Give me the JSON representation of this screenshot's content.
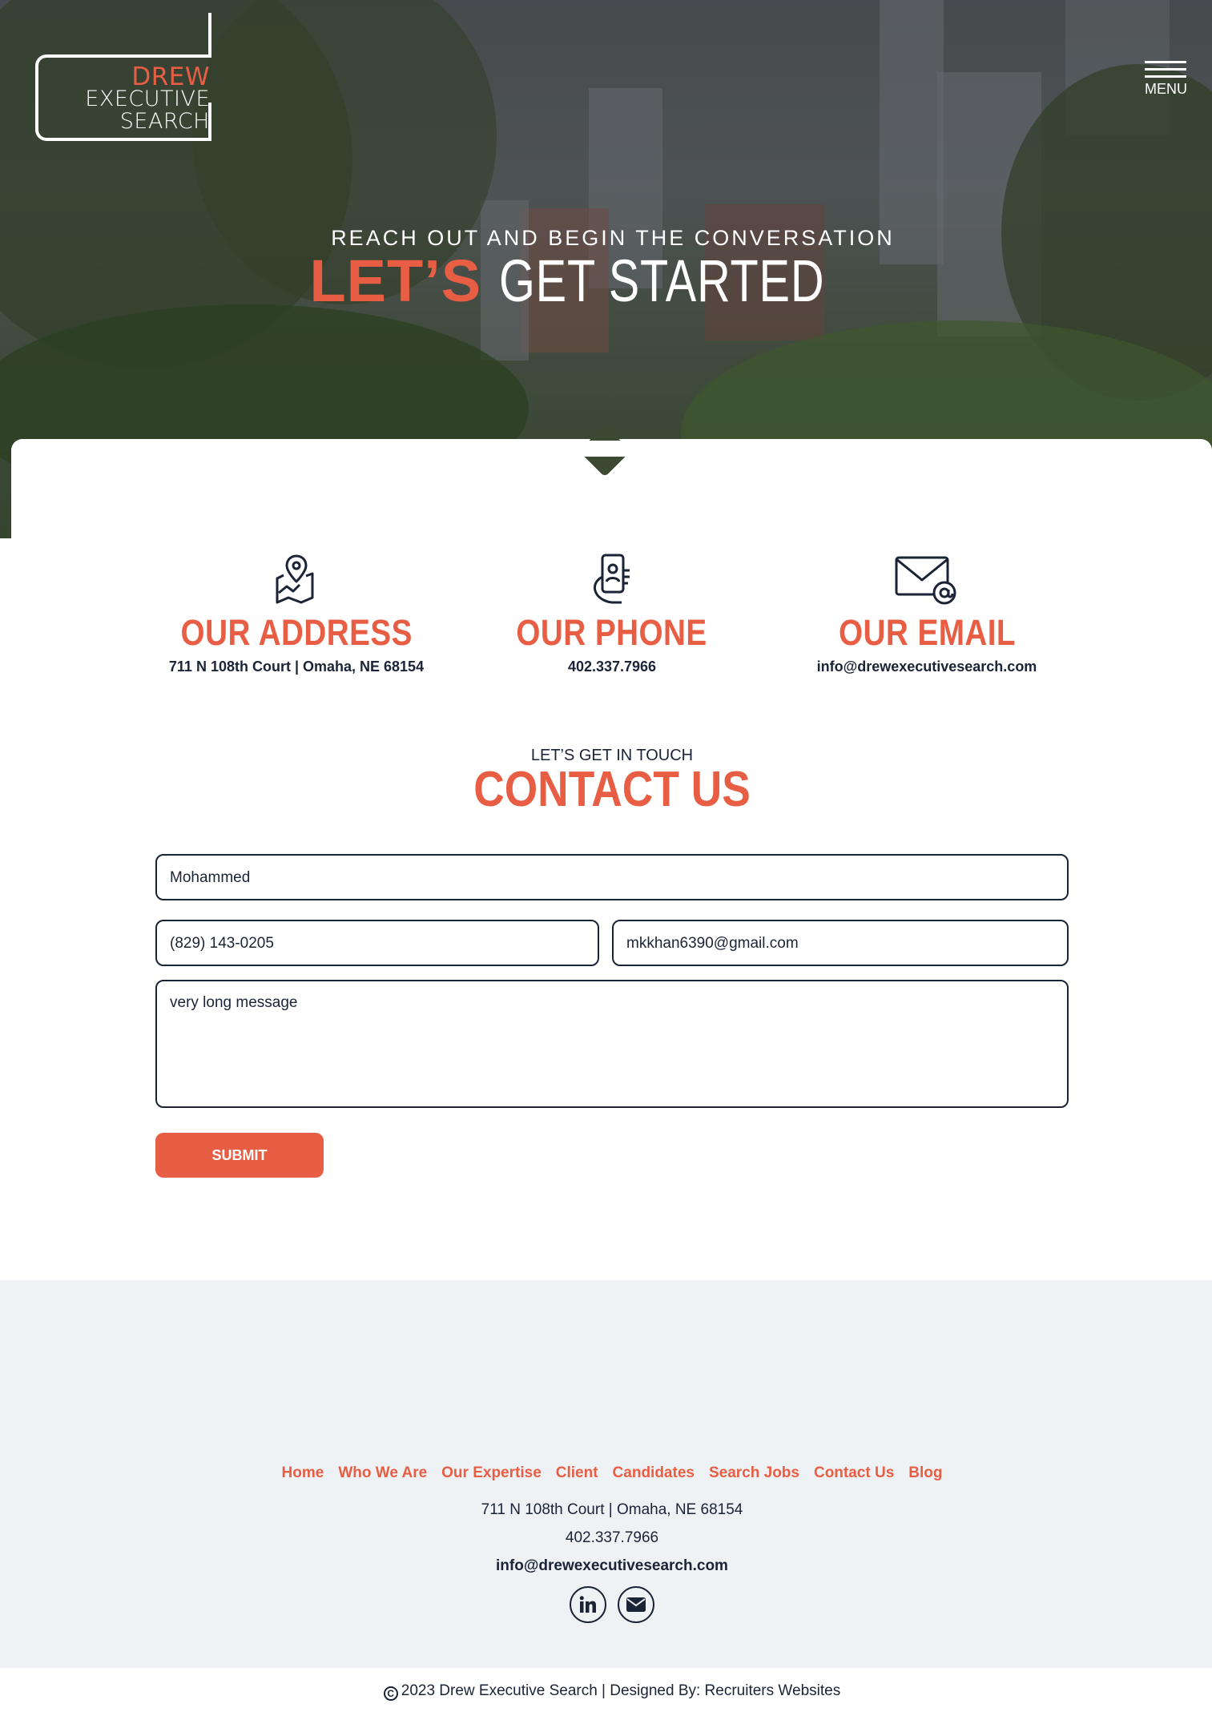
{
  "header": {
    "logo": {
      "line1": "DREW",
      "line2": "EXECUTIVE",
      "line3": "SEARCH"
    },
    "menu_label": "MENU"
  },
  "hero": {
    "kicker": "REACH OUT AND BEGIN THE CONVERSATION",
    "title_accent": "LET’S",
    "title_rest": "GET STARTED"
  },
  "info": [
    {
      "icon": "map-pin-icon",
      "title": "OUR ADDRESS",
      "value": "711 N 108th Court | Omaha, NE 68154"
    },
    {
      "icon": "phone-icon",
      "title": "OUR PHONE",
      "value": "402.337.7966"
    },
    {
      "icon": "email-icon",
      "title": "OUR EMAIL",
      "value": "info@drewexecutivesearch.com"
    }
  ],
  "contact": {
    "kicker": "LET’S GET IN TOUCH",
    "title": "CONTACT US",
    "name_value": "Mohammed",
    "phone_value": "(829) 143-0205",
    "email_value": "mkkhan6390@gmail.com",
    "message_value": "very long message",
    "submit_label": "SUBMIT"
  },
  "footer": {
    "nav": [
      "Home",
      "Who We Are",
      "Our Expertise",
      "Client",
      "Candidates",
      "Search Jobs",
      "Contact Us",
      "Blog"
    ],
    "address": "711 N 108th Court | Omaha, NE 68154",
    "phone": "402.337.7966",
    "email": "info@drewexecutivesearch.com",
    "social": [
      "linkedin-icon",
      "envelope-icon"
    ],
    "copyright": "2023 Drew Executive Search | Designed By: Recruiters Websites"
  },
  "colors": {
    "accent": "#e85e44",
    "text": "#1b2436",
    "footer_bg": "#eff2f5"
  }
}
